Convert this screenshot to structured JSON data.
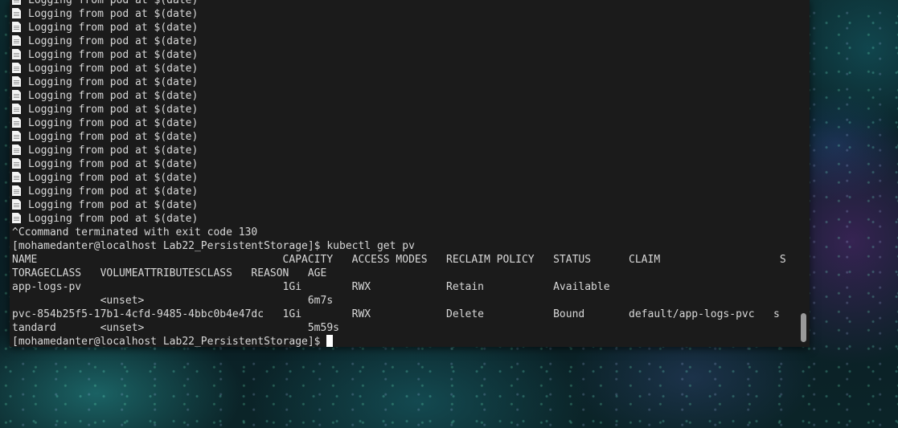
{
  "terminal": {
    "log_line_text": "Logging from pod at $(date)",
    "log_icon": "document-icon",
    "log_lines": 17,
    "terminated": "^Ccommand terminated with exit code 130",
    "prompt": "[mohamedanter@localhost Lab22_PersistentStorage]$ ",
    "command": "kubectl get pv",
    "table_lines": [
      "NAME                                       CAPACITY   ACCESS MODES   RECLAIM POLICY   STATUS      CLAIM                   S",
      "TORAGECLASS   VOLUMEATTRIBUTESCLASS   REASON   AGE",
      "app-logs-pv                                1Gi        RWX            Retain           Available",
      "              <unset>                          6m7s",
      "pvc-854b25f5-17b1-4cfd-9485-4bbc0b4e47dc   1Gi        RWX            Delete           Bound       default/app-logs-pvc   s",
      "tandard       <unset>                          5m59s"
    ]
  }
}
